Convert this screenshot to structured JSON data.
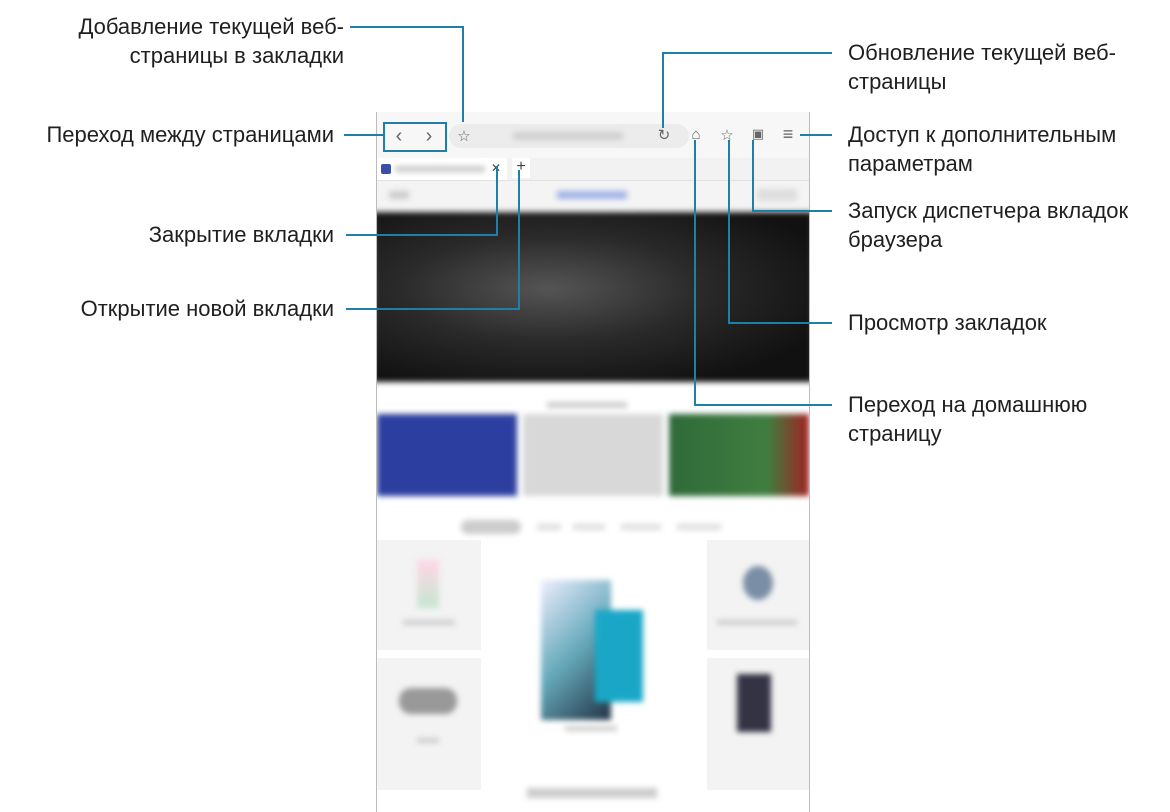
{
  "labels": {
    "bookmark_add": [
      "Добавление текущей веб-",
      "страницы в закладки"
    ],
    "nav_pages": "Переход между страницами",
    "close_tab": "Закрытие вкладки",
    "new_tab": "Открытие новой вкладки",
    "refresh": [
      "Обновление текущей веб-",
      "страницы"
    ],
    "more_options": [
      "Доступ к дополнительным",
      "параметрам"
    ],
    "tab_manager": [
      "Запуск диспетчера вкладок",
      "браузера"
    ],
    "view_bookmarks": "Просмотр закладок",
    "home": [
      "Переход на домашнюю",
      "страницу"
    ]
  },
  "browser": {
    "back_icon": "‹",
    "forward_icon": "›",
    "bookmark_icon": "☆",
    "refresh_icon": "↻",
    "home_icon": "⌂",
    "bookmarks_icon": "☆",
    "tabs_icon": "▣",
    "menu_icon": "≡",
    "close_tab_icon": "✕",
    "new_tab_icon": "+"
  },
  "colors": {
    "callout_line": "#1f7fa8"
  }
}
